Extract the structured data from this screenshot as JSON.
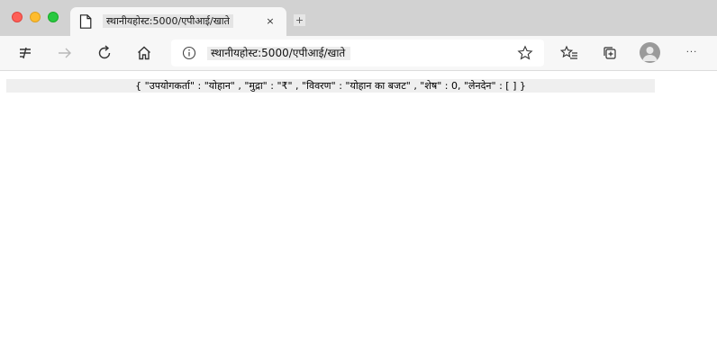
{
  "browser": {
    "tab": {
      "title": "स्थानीयहोस्ट:5000/एपीआई/खाते",
      "close_glyph": "×",
      "icon": "document-icon"
    },
    "new_tab_glyph": "+",
    "toolbar": {
      "address": "स्थानीयहोस्ट:5000/एपीआई/खाते",
      "icons": [
        "split-screen-icon",
        "forward-arrow-icon",
        "reload-icon",
        "home-icon",
        "info-icon",
        "star-icon",
        "favorites-icon",
        "collections-icon",
        "profile-avatar-icon",
        "more-icon"
      ],
      "more_glyph": "···"
    }
  },
  "page": {
    "json_text": "{ \"उपयोगकर्ता\" : \"योहान\" , \"मुद्रा\" : \"₹\" , \"विवरण\" : \"योहान का बजट\" , \"शेष\" : 0, \"लेनदेन\" : [ ] }"
  },
  "colors": {
    "tabstrip": "#d2d2d2",
    "toolbar": "#f7f7f7",
    "close": "#fe5f57",
    "minimize": "#febc2e",
    "maximize": "#28c840"
  }
}
